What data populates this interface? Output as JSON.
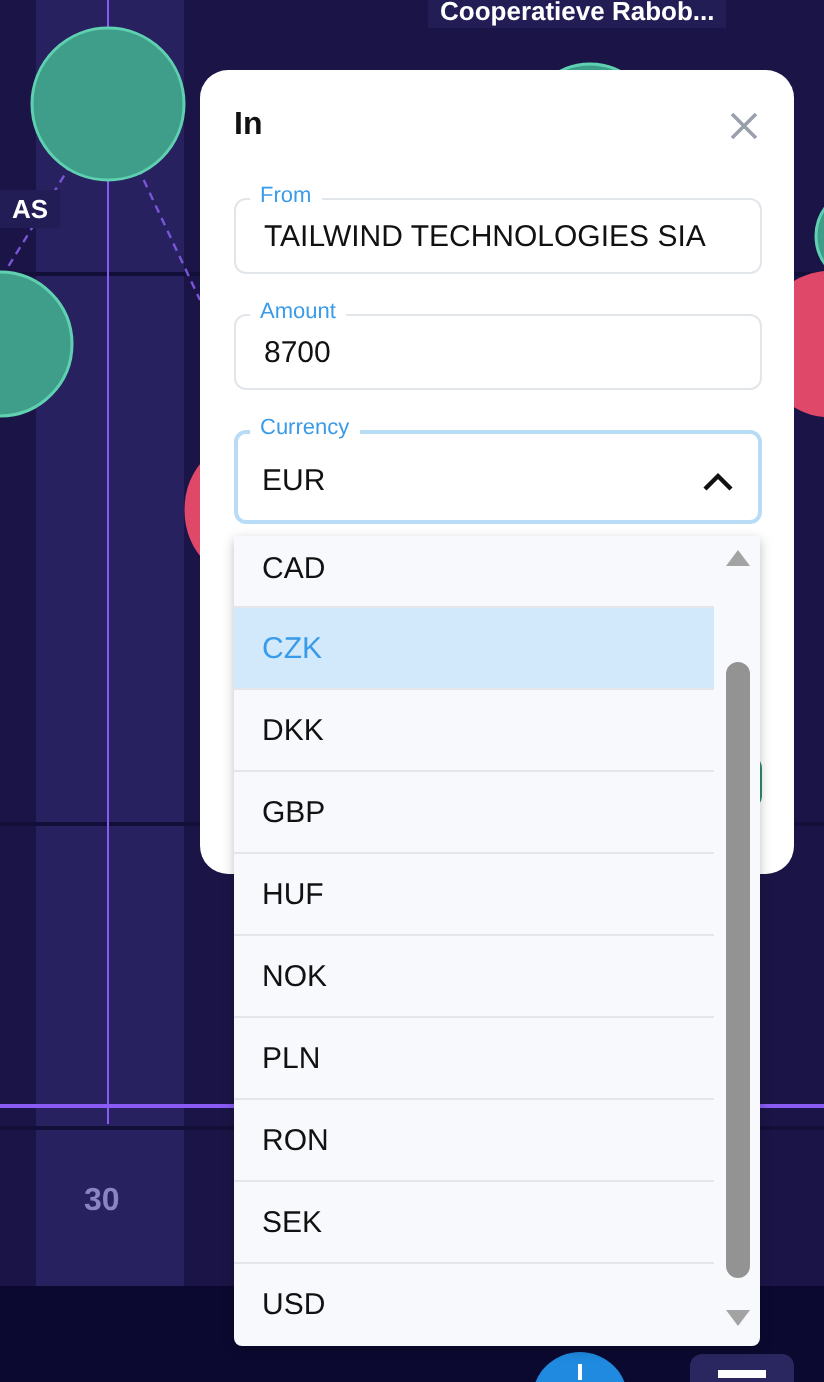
{
  "chart": {
    "x_label": "30",
    "bubbles": [
      {
        "color": "#3f9e8a"
      },
      {
        "color": "#3f9e8a"
      },
      {
        "color": "#e0486a"
      },
      {
        "color": "#e0486a"
      },
      {
        "color": "#3f9e8a"
      },
      {
        "color": "#3f9e8a"
      }
    ],
    "labels": [
      "Cooperatieve Rabob...",
      "AS"
    ]
  },
  "dialog": {
    "title": "In",
    "fields": [
      {
        "label": "From",
        "value": "TAILWIND TECHNOLOGIES SIA",
        "focused": false
      },
      {
        "label": "Amount",
        "value": "8700",
        "focused": false
      },
      {
        "label": "Currency",
        "value": "EUR",
        "focused": true,
        "expanded": true
      }
    ],
    "options": [
      {
        "label": "CAD",
        "selected": false
      },
      {
        "label": "CZK",
        "selected": true
      },
      {
        "label": "DKK",
        "selected": false
      },
      {
        "label": "GBP",
        "selected": false
      },
      {
        "label": "HUF",
        "selected": false
      },
      {
        "label": "NOK",
        "selected": false
      },
      {
        "label": "PLN",
        "selected": false
      },
      {
        "label": "RON",
        "selected": false
      },
      {
        "label": "SEK",
        "selected": false
      },
      {
        "label": "USD",
        "selected": false
      }
    ]
  }
}
